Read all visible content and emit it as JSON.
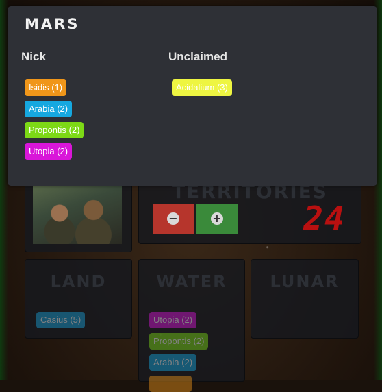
{
  "board": {
    "territories": {
      "title": "Territories",
      "count": "24",
      "minus_icon": "minus-circle-icon",
      "plus_icon": "plus-circle-icon"
    },
    "columns": {
      "land": {
        "title": "Land",
        "chips": [
          {
            "label": "Casius (5)",
            "color": "#1aa3d9"
          }
        ]
      },
      "water": {
        "title": "Water",
        "chips": [
          {
            "label": "Utopia (2)",
            "color": "#d916d9"
          },
          {
            "label": "Propontis (2)",
            "color": "#7dd916"
          },
          {
            "label": "Arabia (2)",
            "color": "#16a8e0"
          },
          {
            "label": "",
            "color": "#f0961a"
          }
        ]
      },
      "lunar": {
        "title": "Lunar",
        "chips": []
      }
    }
  },
  "popup": {
    "title": "Mars",
    "players": [
      {
        "name": "Nick",
        "territories": [
          {
            "label": "Isidis (1)",
            "color": "#f0961a"
          },
          {
            "label": "Arabia (2)",
            "color": "#16a8e0"
          },
          {
            "label": "Propontis (2)",
            "color": "#7dd916"
          },
          {
            "label": "Utopia (2)",
            "color": "#d916d9"
          }
        ]
      },
      {
        "name": "Unclaimed",
        "territories": [
          {
            "label": "Acidalium (3)",
            "color": "#eef542"
          }
        ]
      }
    ]
  }
}
